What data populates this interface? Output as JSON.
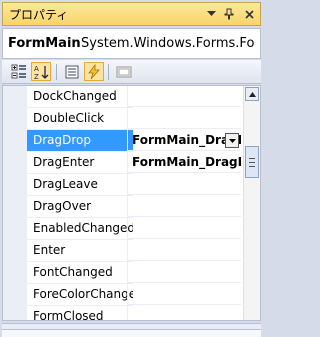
{
  "panel": {
    "title": "プロパティ",
    "object_name": "FormMain",
    "object_type": "System.Windows.Forms.Fo"
  },
  "title_buttons": {
    "dropdown_icon": "chevron-down-icon",
    "pin_icon": "pin-icon",
    "close_icon": "close-icon"
  },
  "toolbar": {
    "buttons": [
      {
        "name": "categorized-button",
        "icon": "categorized-icon"
      },
      {
        "name": "alphabetical-button",
        "icon": "sort-az-icon"
      },
      {
        "name": "properties-button",
        "icon": "properties-list-icon"
      },
      {
        "name": "events-button",
        "icon": "lightning-icon",
        "active": true
      },
      {
        "name": "property-pages-button",
        "icon": "property-pages-icon"
      }
    ]
  },
  "grid": {
    "rows": [
      {
        "name": "DockChanged",
        "value": ""
      },
      {
        "name": "DoubleClick",
        "value": ""
      },
      {
        "name": "DragDrop",
        "value": "FormMain_DragDrop",
        "selected": true
      },
      {
        "name": "DragEnter",
        "value": "FormMain_DragEnter"
      },
      {
        "name": "DragLeave",
        "value": ""
      },
      {
        "name": "DragOver",
        "value": ""
      },
      {
        "name": "EnabledChanged",
        "value": ""
      },
      {
        "name": "Enter",
        "value": ""
      },
      {
        "name": "FontChanged",
        "value": ""
      },
      {
        "name": "ForeColorChanged",
        "value": ""
      },
      {
        "name": "FormClosed",
        "value": ""
      }
    ]
  },
  "colors": {
    "selection": "#3399ff",
    "title_bar": "#fde79a",
    "active_button": "#fbe3a2"
  }
}
